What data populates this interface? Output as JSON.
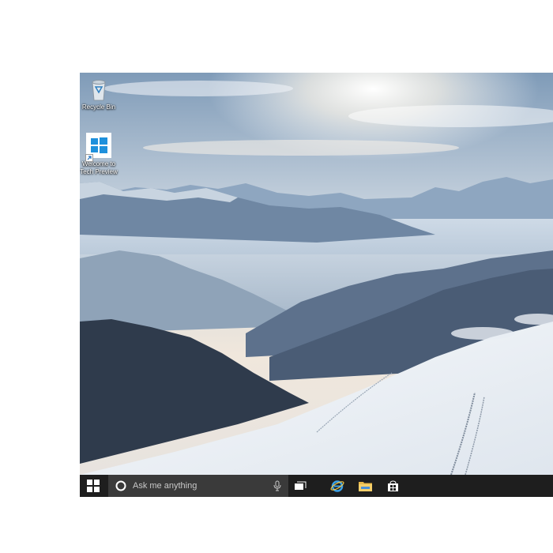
{
  "desktop": {
    "icons": [
      {
        "label": "Recycle Bin",
        "icon": "recycle-bin-icon"
      },
      {
        "label_line1": "Welcome to",
        "label_line2": "Tech Preview",
        "icon": "windows-logo-icon"
      }
    ]
  },
  "taskbar": {
    "start_icon": "windows-logo-icon",
    "search": {
      "placeholder": "Ask me anything",
      "icon": "cortana-icon",
      "mic_icon": "microphone-icon"
    },
    "pinned": [
      {
        "name": "Task View",
        "icon": "task-view-icon"
      },
      {
        "name": "Internet Explorer",
        "icon": "internet-explorer-icon"
      },
      {
        "name": "File Explorer",
        "icon": "file-explorer-icon"
      },
      {
        "name": "Store",
        "icon": "store-icon"
      }
    ]
  },
  "colors": {
    "taskbar": "#1e1e1e",
    "search_box": "#3a3a3a",
    "accent": "#1e90dc"
  }
}
